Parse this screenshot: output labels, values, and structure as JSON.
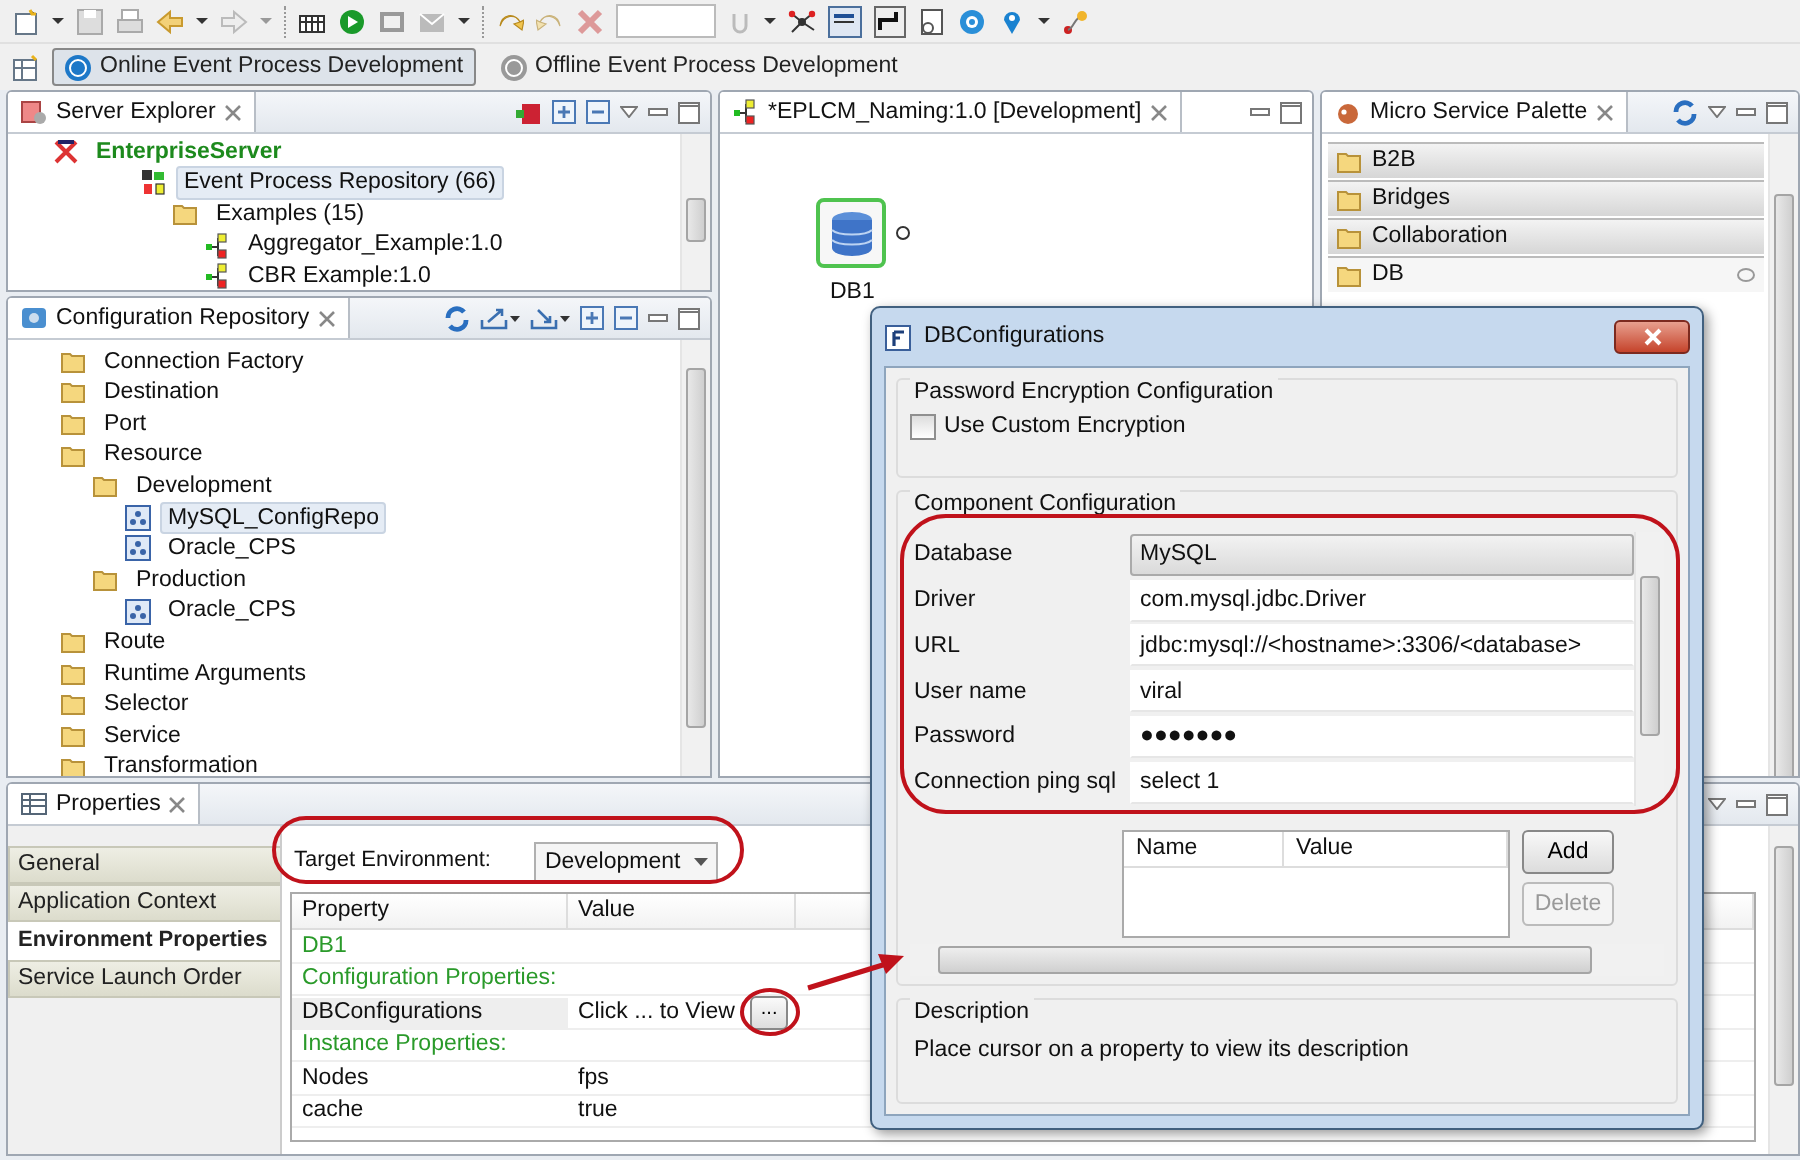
{
  "perspectives": [
    {
      "label": "Online Event Process Development",
      "selected": true
    },
    {
      "label": "Offline Event Process Development",
      "selected": false
    }
  ],
  "server_explorer": {
    "title": "Server Explorer",
    "tree": [
      {
        "label": "EnterpriseServer",
        "kind": "server",
        "selected": false,
        "children": [
          {
            "label": "Event Process Repository (66)",
            "kind": "repository",
            "selected": true,
            "children": [
              {
                "label": "Examples (15)",
                "kind": "folder",
                "selected": false,
                "children": [
                  {
                    "label": "Aggregator_Example:1.0",
                    "kind": "process",
                    "selected": false
                  },
                  {
                    "label": "CBR Example:1.0",
                    "kind": "process",
                    "selected": false
                  }
                ]
              }
            ]
          }
        ]
      }
    ]
  },
  "configuration_repository": {
    "title": "Configuration Repository",
    "tree": [
      {
        "label": "Connection Factory",
        "kind": "folder",
        "selected": false
      },
      {
        "label": "Destination",
        "kind": "folder",
        "selected": false
      },
      {
        "label": "Port",
        "kind": "folder",
        "selected": false
      },
      {
        "label": "Resource",
        "kind": "folder",
        "selected": false,
        "children": [
          {
            "label": "Development",
            "kind": "folder",
            "selected": false,
            "children": [
              {
                "label": "MySQL_ConfigRepo",
                "kind": "config",
                "selected": true
              },
              {
                "label": "Oracle_CPS",
                "kind": "config",
                "selected": false
              }
            ]
          },
          {
            "label": "Production",
            "kind": "folder",
            "selected": false,
            "children": [
              {
                "label": "Oracle_CPS",
                "kind": "config",
                "selected": false
              }
            ]
          }
        ]
      },
      {
        "label": "Route",
        "kind": "folder",
        "selected": false
      },
      {
        "label": "Runtime Arguments",
        "kind": "folder",
        "selected": false
      },
      {
        "label": "Selector",
        "kind": "folder",
        "selected": false
      },
      {
        "label": "Service",
        "kind": "folder",
        "selected": false
      },
      {
        "label": "Transformation",
        "kind": "folder",
        "selected": false
      }
    ]
  },
  "editor": {
    "tab": "*EPLCM_Naming:1.0 [Development]",
    "nodes": [
      {
        "label": "DB1",
        "selected": true
      }
    ]
  },
  "palette": {
    "title": "Micro Service Palette",
    "drawers": [
      {
        "label": "B2B",
        "expanded": false
      },
      {
        "label": "Bridges",
        "expanded": false
      },
      {
        "label": "Collaboration",
        "expanded": false
      },
      {
        "label": "DB",
        "expanded": true
      }
    ]
  },
  "properties": {
    "title": "Properties",
    "tabs": [
      {
        "label": "General",
        "selected": false
      },
      {
        "label": "Application Context",
        "selected": false
      },
      {
        "label": "Environment Properties",
        "selected": true
      },
      {
        "label": "Service Launch Order",
        "selected": false
      }
    ],
    "target_environment": {
      "label": "Target Environment:",
      "value": "Development"
    },
    "table": {
      "columns": [
        "Property",
        "Value"
      ],
      "rows": [
        {
          "kind": "section",
          "property": "DB1"
        },
        {
          "kind": "section",
          "property": "Configuration Properties:"
        },
        {
          "kind": "dialog",
          "property": "DBConfigurations",
          "value": "Click ... to View",
          "button": "..."
        },
        {
          "kind": "section",
          "property": "Instance Properties:"
        },
        {
          "kind": "plain",
          "property": "Nodes",
          "value": "fps"
        },
        {
          "kind": "plain",
          "property": "cache",
          "value": "true"
        }
      ]
    }
  },
  "dialog": {
    "title": "DBConfigurations",
    "encryption": {
      "title": "Password Encryption Configuration",
      "checkbox": {
        "label": "Use Custom Encryption",
        "checked": false
      }
    },
    "component": {
      "title": "Component Configuration",
      "fields": [
        {
          "label": "Database",
          "kind": "combo",
          "value": "MySQL"
        },
        {
          "label": "Driver",
          "kind": "text",
          "value": "com.mysql.jdbc.Driver"
        },
        {
          "label": "URL",
          "kind": "text",
          "value": "jdbc:mysql://<hostname>:3306/<database>"
        },
        {
          "label": "User name",
          "kind": "text",
          "value": "viral"
        },
        {
          "label": "Password",
          "kind": "text",
          "value": "●●●●●●●"
        },
        {
          "label": "Connection ping sql",
          "kind": "text",
          "value": "select 1"
        }
      ],
      "table": {
        "columns": [
          "Name",
          "Value"
        ]
      },
      "buttons": [
        {
          "label": "Add",
          "disabled": false
        },
        {
          "label": "Delete",
          "disabled": true
        }
      ]
    },
    "description": {
      "title": "Description",
      "text": "Place cursor on a property to view its description"
    }
  }
}
